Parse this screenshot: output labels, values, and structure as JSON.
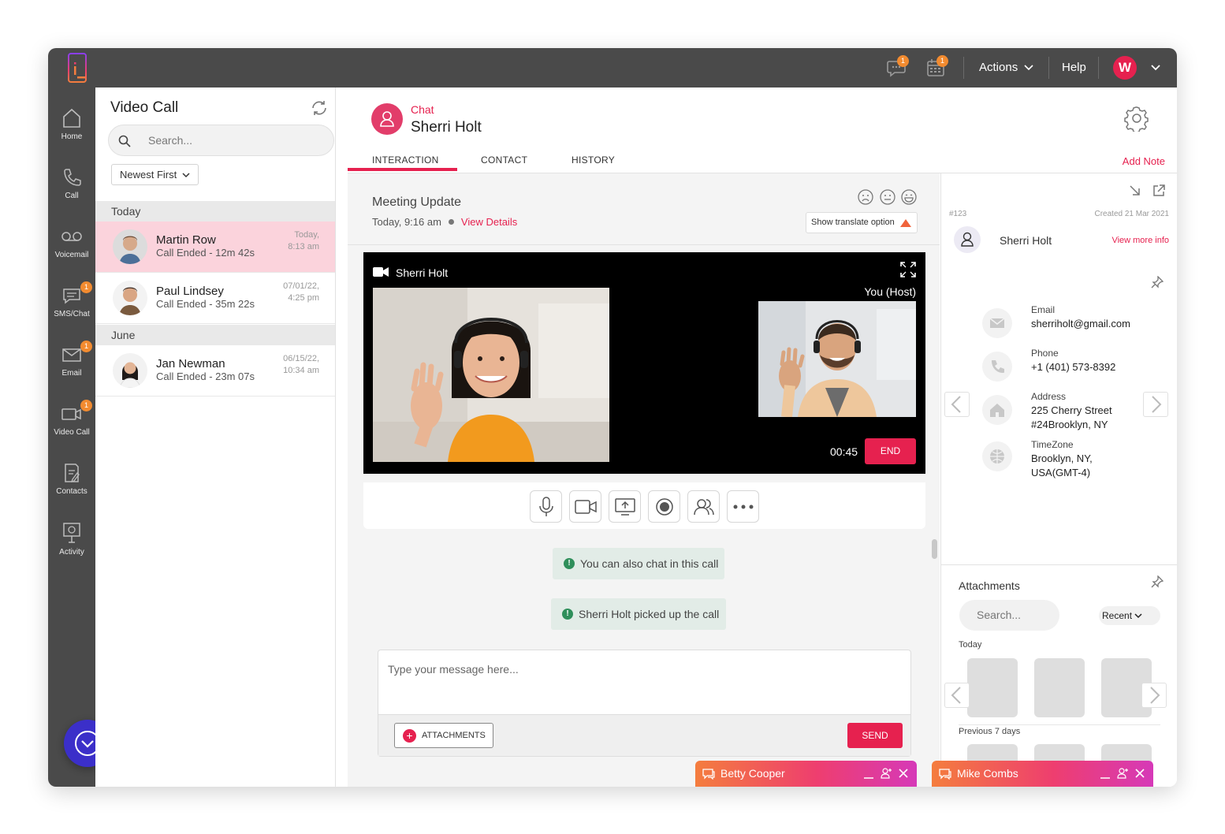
{
  "topbar": {
    "chat_badge": "1",
    "calendar_badge": "1",
    "actions_label": "Actions",
    "help_label": "Help",
    "avatar_initial": "W"
  },
  "nav": [
    {
      "label": "Home",
      "icon": "home-icon",
      "badge": ""
    },
    {
      "label": "Call",
      "icon": "phone-icon",
      "badge": ""
    },
    {
      "label": "Voicemail",
      "icon": "voicemail-icon",
      "badge": ""
    },
    {
      "label": "SMS/Chat",
      "icon": "chat-icon",
      "badge": "1"
    },
    {
      "label": "Email",
      "icon": "mail-icon",
      "badge": "1"
    },
    {
      "label": "Video Call",
      "icon": "video-icon",
      "badge": "1"
    },
    {
      "label": "Contacts",
      "icon": "contacts-icon",
      "badge": ""
    },
    {
      "label": "Activity",
      "icon": "activity-icon",
      "badge": ""
    }
  ],
  "list": {
    "title": "Video Call",
    "search_placeholder": "Search...",
    "sort_label": "Newest First",
    "groups": [
      {
        "label": "Today"
      },
      {
        "label": "June"
      }
    ],
    "items": [
      {
        "name": "Martin Row",
        "status": "Call Ended - 12m 42s",
        "time_line1": "Today,",
        "time_line2": "8:13 am",
        "active": true
      },
      {
        "name": "Paul Lindsey",
        "status": "Call Ended - 35m 22s",
        "time_line1": "07/01/22,",
        "time_line2": "4:25 pm",
        "active": false
      },
      {
        "name": "Jan Newman",
        "status": "Call Ended - 23m 07s",
        "time_line1": "06/15/22,",
        "time_line2": "10:34 am",
        "active": false
      }
    ]
  },
  "header": {
    "channel": "Chat",
    "contact_name": "Sherri Holt",
    "tabs": [
      "INTERACTION",
      "CONTACT",
      "HISTORY"
    ],
    "active_tab": "INTERACTION",
    "add_note": "Add Note"
  },
  "meeting": {
    "title": "Meeting Update",
    "time": "Today, 9:16 am",
    "details_link": "View Details",
    "translate_label": "Show translate option"
  },
  "video": {
    "caller_name": "Sherri Holt",
    "self_label": "You (Host)",
    "timer": "00:45",
    "end_label": "END"
  },
  "controls": [
    "microphone-icon",
    "camera-icon",
    "screen-share-icon",
    "record-icon",
    "participants-icon",
    "more-icon"
  ],
  "notices": [
    {
      "text": "You can also chat in this call"
    },
    {
      "text": "Sherri Holt picked up the call"
    }
  ],
  "composer": {
    "placeholder": "Type your message here...",
    "attachments_label": "ATTACHMENTS",
    "send_label": "SEND"
  },
  "chat_windows": [
    {
      "name": "Betty Cooper"
    },
    {
      "name": "Mike Combs"
    }
  ],
  "contact_card": {
    "id": "#123",
    "created": "Created 21 Mar 2021",
    "name": "Sherri Holt",
    "view_more": "View more info",
    "fields": [
      {
        "label": "Email",
        "lines": [
          "sherriholt@gmail.com"
        ],
        "icon": "mail-icon"
      },
      {
        "label": "Phone",
        "lines": [
          "+1 (401) 573-8392"
        ],
        "icon": "phone-icon"
      },
      {
        "label": "Address",
        "lines": [
          "225 Cherry Street",
          "#24Brooklyn, NY"
        ],
        "icon": "home-icon"
      },
      {
        "label": "TimeZone",
        "lines": [
          "Brooklyn, NY,",
          "USA(GMT-4)"
        ],
        "icon": "globe-icon"
      }
    ]
  },
  "attachments": {
    "title": "Attachments",
    "search_placeholder": "Search...",
    "filter_label": "Recent",
    "sections": [
      "Today",
      "Previous 7 days"
    ]
  },
  "colors": {
    "accent": "#e6214f",
    "topbar": "#4a4a4a",
    "active_row": "#fbd3dc",
    "fab": "#3b2fc9"
  }
}
